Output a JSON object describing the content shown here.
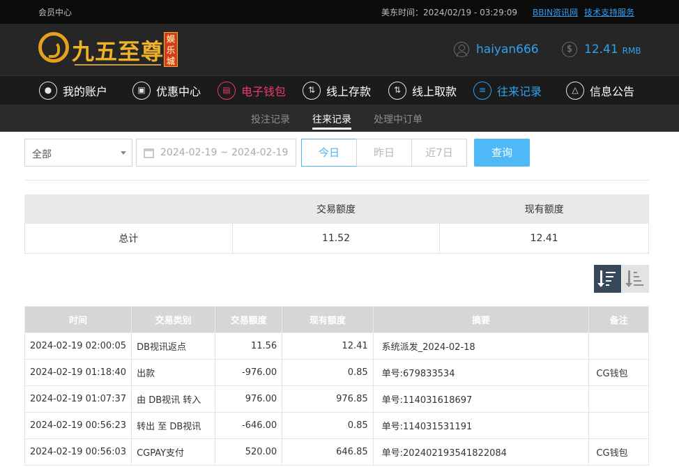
{
  "topbar": {
    "member_center": "会员中心",
    "time_label": "美东时间：2024/02/19 - 03:29:09",
    "link_info": "BBIN资讯网",
    "link_support": "技术支持服务"
  },
  "logo": {
    "text": "九五至尊",
    "badge": "娱乐城"
  },
  "user": {
    "username": "haiyan666",
    "balance": "12.41",
    "currency": "RMB"
  },
  "nav": {
    "items": [
      {
        "label": "我的账户",
        "icon": "user-icon"
      },
      {
        "label": "优惠中心",
        "icon": "gift-icon"
      },
      {
        "label": "电子钱包",
        "icon": "wallet-icon"
      },
      {
        "label": "线上存款",
        "icon": "deposit-icon"
      },
      {
        "label": "线上取款",
        "icon": "withdraw-icon"
      },
      {
        "label": "往来记录",
        "icon": "record-icon"
      },
      {
        "label": "信息公告",
        "icon": "bell-icon"
      }
    ]
  },
  "subnav": {
    "items": [
      {
        "label": "投注记录"
      },
      {
        "label": "往来记录"
      },
      {
        "label": "处理中订单"
      }
    ]
  },
  "filter": {
    "select_value": "全部",
    "date_range": "2024-02-19 ~ 2024-02-19",
    "today": "今日",
    "yesterday": "昨日",
    "last7": "近7日",
    "query": "查询"
  },
  "summary": {
    "headers": [
      "",
      "交易额度",
      "现有额度"
    ],
    "row": {
      "label": "总计",
      "trade": "11.52",
      "current": "12.41"
    }
  },
  "records": {
    "headers": [
      "时间",
      "交易类别",
      "交易额度",
      "现有额度",
      "摘要",
      "备注"
    ],
    "rows": [
      {
        "time": "2024-02-19 02:00:05",
        "type": "DB视讯返点",
        "amount": "11.56",
        "balance": "12.41",
        "summary": "系统派发_2024-02-18",
        "note": ""
      },
      {
        "time": "2024-02-19 01:18:40",
        "type": "出款",
        "amount": "-976.00",
        "balance": "0.85",
        "summary": "单号:679833534",
        "note": "CG钱包"
      },
      {
        "time": "2024-02-19 01:07:37",
        "type": "由 DB视讯 转入",
        "amount": "976.00",
        "balance": "976.85",
        "summary": "单号:114031618697",
        "note": ""
      },
      {
        "time": "2024-02-19 00:56:23",
        "type": "转出 至 DB视讯",
        "amount": "-646.00",
        "balance": "0.85",
        "summary": "单号:114031531191",
        "note": ""
      },
      {
        "time": "2024-02-19 00:56:03",
        "type": "CGPAY支付",
        "amount": "520.00",
        "balance": "646.85",
        "summary": "单号:202402193541822084",
        "note": "CG钱包"
      }
    ]
  }
}
